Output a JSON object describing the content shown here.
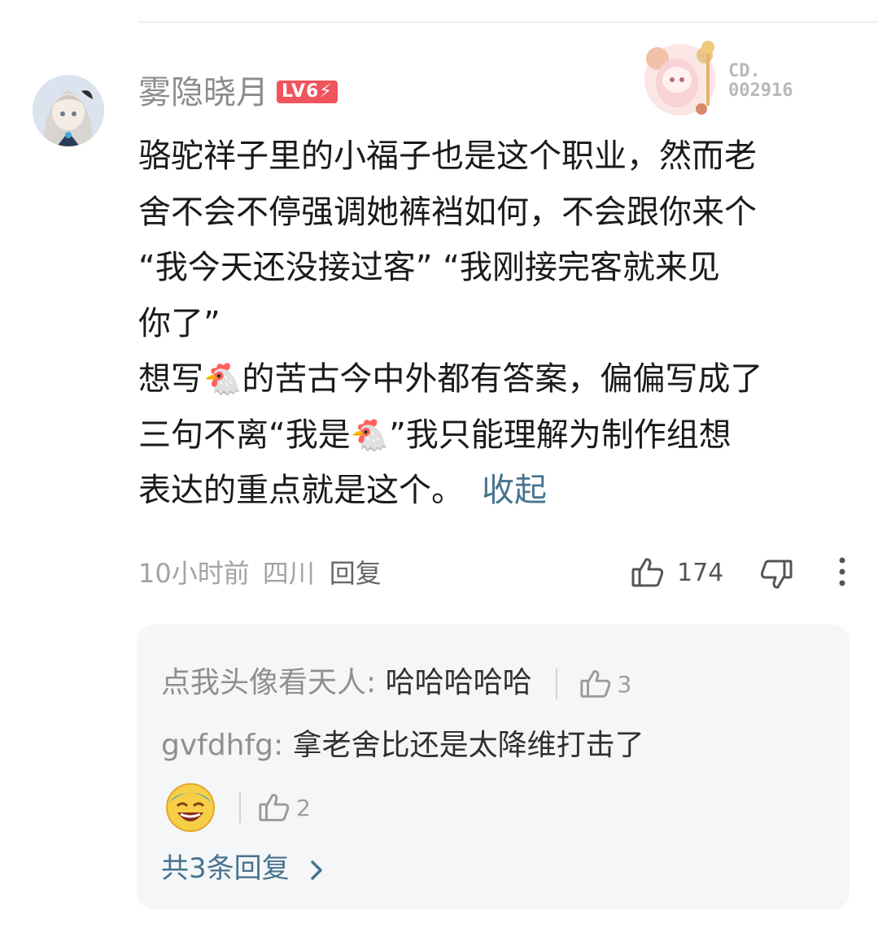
{
  "comment": {
    "username": "雾隐晓月",
    "level_badge": "LV6⚡",
    "decor_serial": "CD.\n002916",
    "content_lines": [
      "骆驼祥子里的小福子也是这个职业，然而老",
      "舍不会不停强调她裤裆如何，不会跟你来个",
      "“我今天还没接过客” “我刚接完客就来见",
      "你了”"
    ],
    "content_line5_a": "想写",
    "content_line5_b": "的苦古今中外都有答案，偏偏写成了",
    "content_line6_a": "三句不离“我是",
    "content_line6_b": "”我只能理解为制作组想",
    "content_line7": "表达的重点就是这个。",
    "emoji_chicken": "🐔",
    "collapse_label": "收起",
    "time": "10小时前",
    "location": "四川",
    "reply_label": "回复",
    "like_count": "174"
  },
  "replies": {
    "items": [
      {
        "user": "点我头像看天人",
        "sep": ":",
        "text": "哈哈哈哈哈",
        "like_count": "3"
      },
      {
        "user": "gvfdhfg",
        "sep": ":",
        "text": "拿老舍比还是太降维打击了",
        "like_count": "2"
      }
    ],
    "total_label": "共3条回复"
  },
  "colors": {
    "link": "#47738f",
    "badge": "#f0545c",
    "muted": "#8c8c8c",
    "panel": "#f5f6f8"
  },
  "icons": [
    "thumb-up-icon",
    "thumb-down-icon",
    "more-vertical-icon",
    "chevron-right-icon",
    "laughing-emoji-icon"
  ]
}
